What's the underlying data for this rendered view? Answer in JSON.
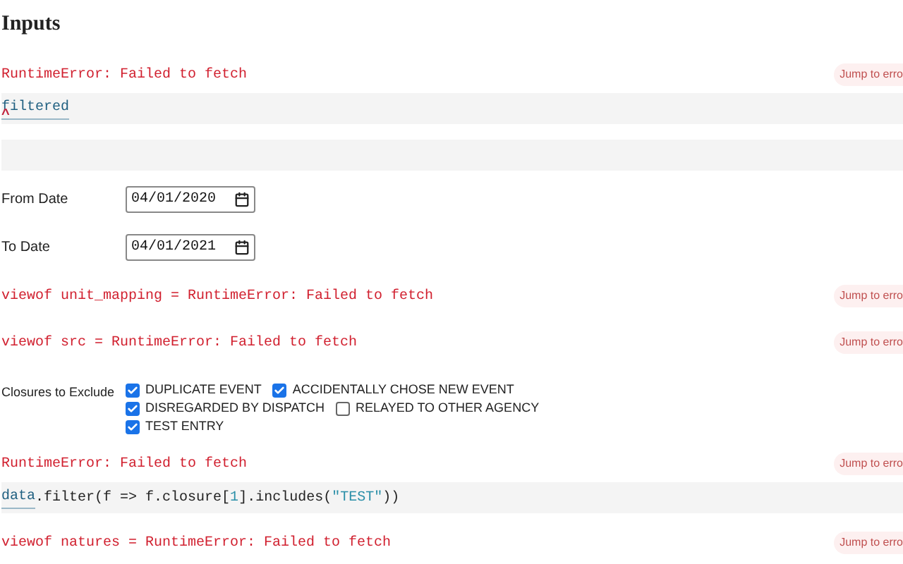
{
  "cells": [
    {
      "kind": "heading",
      "text": "Inputs"
    },
    {
      "kind": "error",
      "text": "RuntimeError: Failed to fetch",
      "jump": "Jump to erro"
    },
    {
      "kind": "code",
      "tokens": [
        {
          "kind": "ref",
          "text": "filtered"
        }
      ],
      "caret": "^"
    },
    {
      "kind": "blank"
    },
    {
      "kind": "date",
      "label": "From Date",
      "value": "04/01/2020"
    },
    {
      "kind": "date",
      "label": "To Date",
      "value": "04/01/2021"
    },
    {
      "kind": "error",
      "text": "viewof unit_mapping = RuntimeError: Failed to fetch",
      "jump": "Jump to erro"
    },
    {
      "kind": "error",
      "text": "viewof src = RuntimeError: Failed to fetch",
      "jump": "Jump to erro"
    },
    {
      "kind": "checkboxes",
      "label": "Closures to Exclude",
      "options": [
        {
          "label": "DUPLICATE EVENT",
          "checked": true
        },
        {
          "label": "ACCIDENTALLY CHOSE NEW EVENT",
          "checked": true
        },
        {
          "label": "DISREGARDED BY DISPATCH",
          "checked": true
        },
        {
          "label": "RELAYED TO OTHER AGENCY",
          "checked": false
        },
        {
          "label": "TEST ENTRY",
          "checked": true
        }
      ]
    },
    {
      "kind": "error",
      "text": "RuntimeError: Failed to fetch",
      "jump": "Jump to erro"
    },
    {
      "kind": "code",
      "tokens": [
        {
          "kind": "ref",
          "text": "data"
        },
        {
          "kind": "plain",
          "text": ".filter(f => f.closure["
        },
        {
          "kind": "literal",
          "text": "1"
        },
        {
          "kind": "plain",
          "text": "].includes("
        },
        {
          "kind": "literal",
          "text": "\"TEST\""
        },
        {
          "kind": "plain",
          "text": "))"
        }
      ]
    },
    {
      "kind": "error",
      "text": "viewof natures = RuntimeError: Failed to fetch",
      "jump": "Jump to erro"
    }
  ]
}
